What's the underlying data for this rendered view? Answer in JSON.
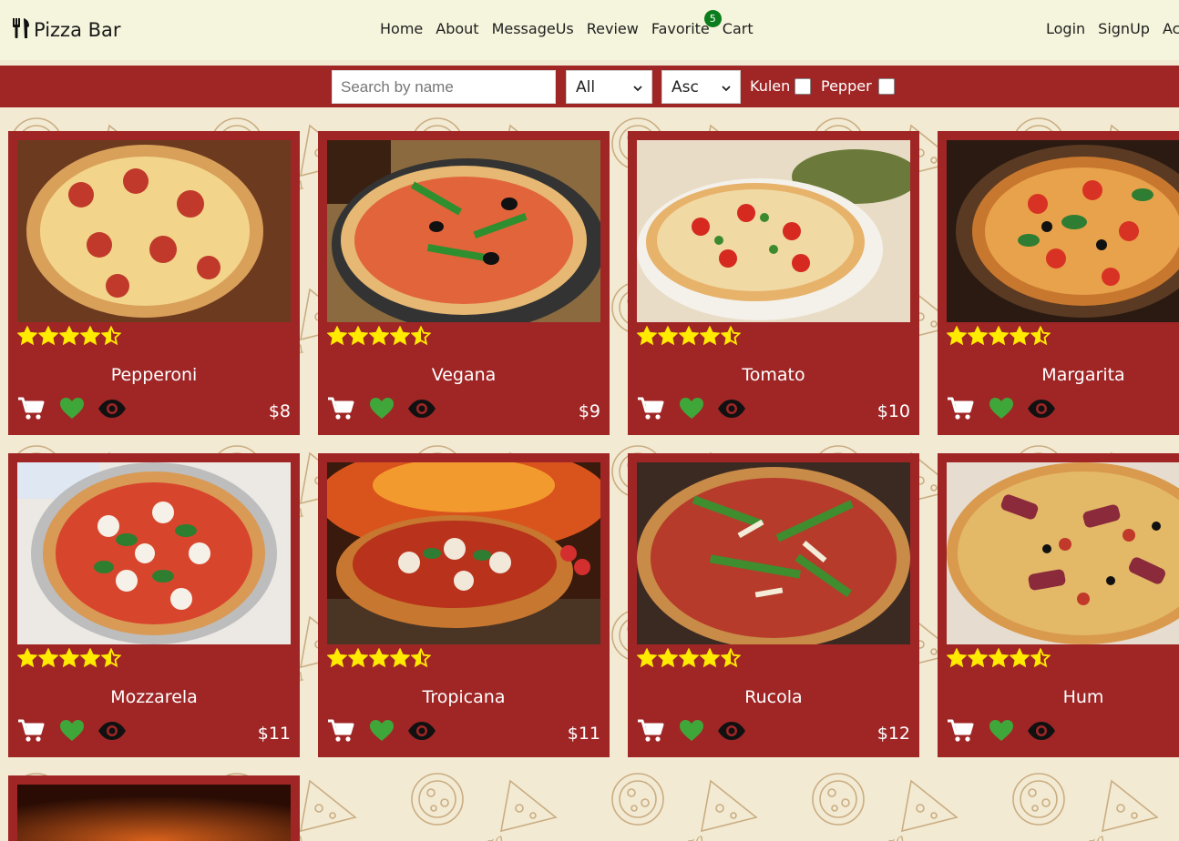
{
  "brand": {
    "name": "Pizza Bar"
  },
  "nav": {
    "links": [
      "Home",
      "About",
      "MessageUs",
      "Review",
      "Favorite",
      "Cart"
    ],
    "favorite_count": "5",
    "auth": [
      "Login",
      "SignUp",
      "Ac"
    ]
  },
  "filter": {
    "search_placeholder": "Search by name",
    "category": "All",
    "order": "Asc",
    "kulen_label": "Kulen",
    "pepper_label": "Pepper"
  },
  "products": [
    {
      "name": "Pepperoni",
      "price": "$8",
      "rating": 4.5
    },
    {
      "name": "Vegana",
      "price": "$9",
      "rating": 4.5
    },
    {
      "name": "Tomato",
      "price": "$10",
      "rating": 4.5
    },
    {
      "name": "Margarita",
      "price": "",
      "rating": 4.5
    },
    {
      "name": "Mozzarela",
      "price": "$11",
      "rating": 4.5
    },
    {
      "name": "Tropicana",
      "price": "$11",
      "rating": 4.5
    },
    {
      "name": "Rucola",
      "price": "$12",
      "rating": 4.5
    },
    {
      "name": "Hum",
      "price": "",
      "rating": 4.5
    }
  ],
  "colors": {
    "accent": "#a02626",
    "star": "#ffea00",
    "heart": "#3fa63a",
    "badge": "#0b7d1c",
    "background": "#f3ead3"
  }
}
